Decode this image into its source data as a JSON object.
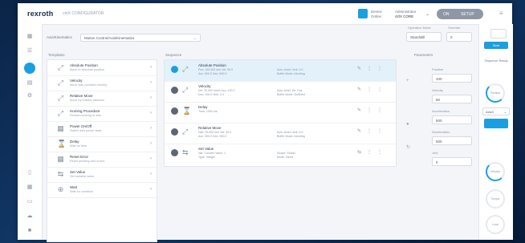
{
  "header": {
    "logo": "rexroth",
    "app_title": "ctrlX CONFIGURATOR",
    "item1_line1": "Device",
    "item1_line2": "Online",
    "user_line1": "Administrator",
    "user_line2": "ctrlX CORE",
    "pill_left": "ON",
    "pill_right": "SETUP"
  },
  "sidebar": {
    "icons": [
      "grid-icon",
      "list-icon",
      "axis-icon",
      "chart-icon",
      "gear-icon",
      "file-icon",
      "table-icon",
      "terminal-icon",
      "cloud-icon",
      "network-icon"
    ]
  },
  "filter": {
    "label": "Axis/Kinematics",
    "selected": "Motion Control/Axis/Kinematics",
    "field1_label": "Operation Mode",
    "field1_value": "Standstill",
    "field2_label": "Override",
    "field2_value": "0"
  },
  "templates": {
    "title": "Templates",
    "items": [
      {
        "name": "Absolute Position",
        "sub": "Move to absolute position"
      },
      {
        "name": "Velocity",
        "sub": "Move with constant velocity"
      },
      {
        "name": "Relative Move",
        "sub": "Move by relative distance"
      },
      {
        "name": "Homing Procedure",
        "sub": "Perform homing of axis"
      },
      {
        "name": "Power On/Off",
        "sub": "Switch axis power state"
      },
      {
        "name": "Delay",
        "sub": "Wait for time"
      },
      {
        "name": "Reset Error",
        "sub": "Reset pending axis errors"
      },
      {
        "name": "Set Value",
        "sub": "Set variable value"
      },
      {
        "name": "Wait",
        "sub": "Wait for condition"
      }
    ]
  },
  "sequence": {
    "title": "Sequence",
    "items": [
      {
        "name": "Absolute Position",
        "l1": "Pos: 100.000 mm  Vel: 50.0",
        "l2": "Acc: 500.0  Dec: 500.0",
        "r1": "Axis: AxisX  Jerk: 0.0",
        "r2": "Buffer Mode: Aborting"
      },
      {
        "name": "Velocity",
        "l1": "Vel: 20.000 mm/s  Acc: 100.0",
        "l2": "Dec: 100.0  Jerk: 0.0",
        "r1": "Axis: AxisY  Dir: Pos",
        "r2": "Buffer Mode: Buffered"
      },
      {
        "name": "Delay",
        "l1": "Time: 1000 ms",
        "l2": "",
        "r1": "",
        "r2": ""
      },
      {
        "name": "Relative Move",
        "l1": "Dist: 25.000 mm  Vel: 30.0",
        "l2": "Acc: 300.0  Dec: 300.0",
        "r1": "Axis: AxisX  Jerk: 0.0",
        "r2": "Buffer Mode: Aborting"
      },
      {
        "name": "Set Value",
        "l1": "Var: Counter  Value: 1",
        "l2": "Type: Integer",
        "r1": "Scope: Global",
        "r2": "Mode: Direct"
      }
    ]
  },
  "params": {
    "title": "Parameters",
    "fields": [
      {
        "label": "Position",
        "value": "100"
      },
      {
        "label": "Velocity",
        "value": "50"
      },
      {
        "label": "Acceleration",
        "value": "500"
      },
      {
        "label": "Deceleration",
        "value": "500"
      },
      {
        "label": "Jerk",
        "value": "0"
      }
    ]
  },
  "rightrail": {
    "btn": "Start",
    "status": "Sequence Ready",
    "gauge1": "Position",
    "select": "AxisX",
    "gauge2": "Velocity",
    "gauge3": "Torque",
    "gauge4": "Load"
  },
  "colors": {
    "accent": "#1a9fe0",
    "panel": "#ffffff",
    "background": "#f3f5f8"
  }
}
